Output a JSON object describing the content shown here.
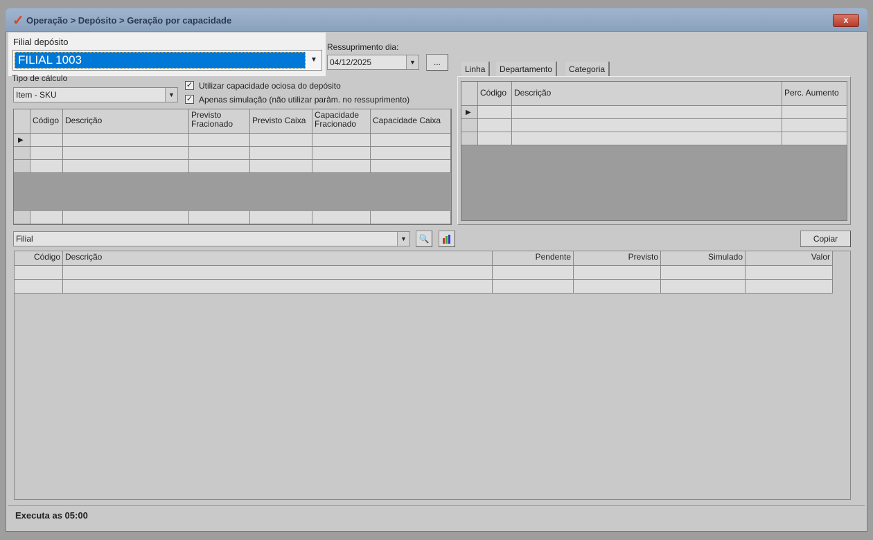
{
  "window": {
    "title": "Operação > Depósito > Geração por capacidade",
    "close_label": "x"
  },
  "filial_deposito": {
    "label": "Filial depósito",
    "value": "FILIAL 1003"
  },
  "ressuprimento": {
    "label": "Ressuprimento dia:",
    "value": "04/12/2025",
    "button_label": "..."
  },
  "tipo_calculo": {
    "label": "Tipo de cálculo",
    "value": "Item - SKU"
  },
  "checkboxes": [
    {
      "label": "Utilizar capacidade ociosa do depósito",
      "checked": true
    },
    {
      "label": "Apenas simulação (não utilizar parâm. no ressuprimento)",
      "checked": true
    }
  ],
  "items_grid": {
    "columns": [
      "Código",
      "Descrição",
      "Previsto\nFracionado",
      "Previsto Caixa",
      "Capacidade\nFracionado",
      "Capacidade Caixa"
    ]
  },
  "tabs": [
    {
      "label": "Linha"
    },
    {
      "label": "Departamento"
    },
    {
      "label": "Categoria"
    }
  ],
  "aumento_grid": {
    "columns": [
      "Código",
      "Descrição",
      "Perc. Aumento"
    ]
  },
  "filial_filter": {
    "value": "Filial"
  },
  "copy_button": "Copiar",
  "result_grid": {
    "columns": [
      "Código",
      "Descrição",
      "Pendente",
      "Previsto",
      "Simulado",
      "Valor"
    ]
  },
  "status": "Executa as 05:00",
  "check_mark": "✓",
  "row_pointer": "▶"
}
